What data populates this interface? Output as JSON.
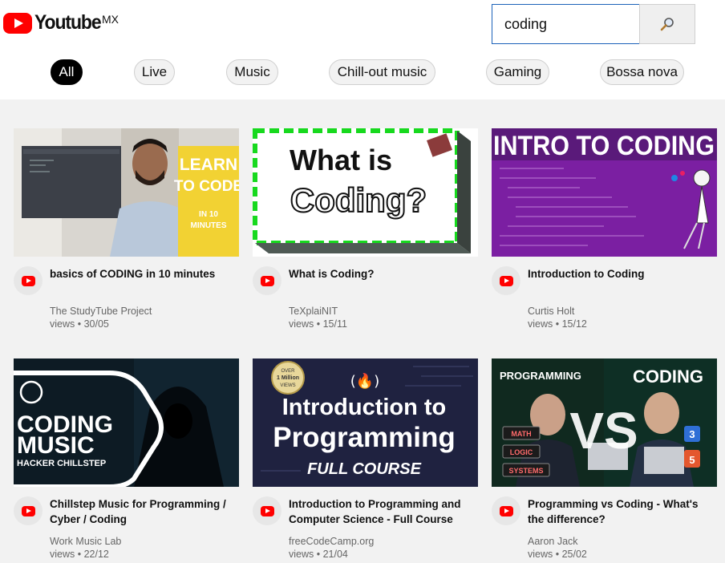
{
  "brand": {
    "name": "Youtube",
    "region": "MX"
  },
  "search": {
    "value": "coding",
    "button_icon": "magnifier-icon"
  },
  "chips": [
    "All",
    "Live",
    "Music",
    "Chill-out music",
    "Gaming",
    "Bossa nova"
  ],
  "active_chip": "All",
  "videos": [
    {
      "title": "basics of CODING in 10 minutes",
      "channel": "The StudyTube Project",
      "views": "views",
      "date": "30/05",
      "thumb_text": {
        "line1": "LEARN",
        "line2": "TO CODE",
        "line3": "IN 10",
        "line4": "MINUTES"
      }
    },
    {
      "title": "What is Coding?",
      "channel": "TeXplaiNIT",
      "views": "views",
      "date": "15/11",
      "thumb_text": {
        "line1": "What is",
        "line2": "Coding?"
      }
    },
    {
      "title": "Introduction to Coding",
      "channel": "Curtis Holt",
      "views": "views",
      "date": "15/12",
      "thumb_text": {
        "line1": "INTRO TO CODING"
      }
    },
    {
      "title": "Chillstep Music for Programming / Cyber / Coding",
      "channel": "Work Music Lab",
      "views": "views",
      "date": "22/12",
      "thumb_text": {
        "line1": "CODING",
        "line2": "MUSIC",
        "line3": "HACKER CHILLSTEP"
      }
    },
    {
      "title": "Introduction to Programming and Computer Science - Full Course",
      "channel": "freeCodeCamp.org",
      "views": "views",
      "date": "21/04",
      "thumb_text": {
        "line1": "Introduction to",
        "line2": "Programming",
        "line3": "FULL COURSE",
        "badge_top": "OVER",
        "badge_mid": "1 Million",
        "badge_bot": "VIEWS",
        "logo": "(🔥)"
      }
    },
    {
      "title": "Programming vs Coding - What's the difference?",
      "channel": "Aaron Jack",
      "views": "views",
      "date": "25/02",
      "thumb_text": {
        "line1": "PROGRAMMING",
        "line2": "CODING",
        "vs": "VS",
        "tag1": "MATH",
        "tag2": "LOGIC",
        "tag3": "SYSTEMS",
        "num1": "3",
        "num2": "5"
      }
    }
  ],
  "colors": {
    "brand_red": "#ff0000",
    "accent_blue": "#1c62b9"
  }
}
